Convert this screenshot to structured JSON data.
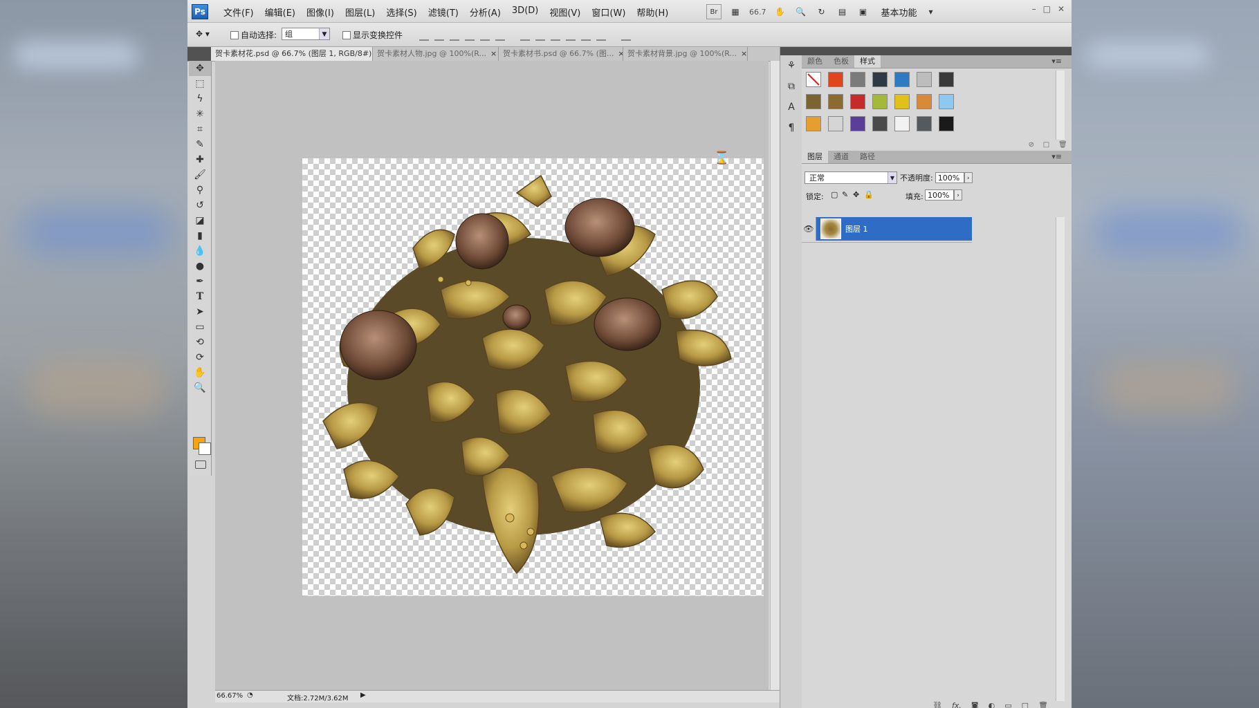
{
  "app": {
    "logo": "Ps"
  },
  "menu": [
    "文件(F)",
    "编辑(E)",
    "图像(I)",
    "图层(L)",
    "选择(S)",
    "滤镜(T)",
    "分析(A)",
    "3D(D)",
    "视图(V)",
    "窗口(W)",
    "帮助(H)"
  ],
  "appbar": {
    "bridge": "Br",
    "zoom": "66.7",
    "workspace": "基本功能"
  },
  "options": {
    "auto_select_label": "自动选择:",
    "auto_select_value": "组",
    "transform_label": "显示变换控件"
  },
  "tabs": [
    {
      "label": "贺卡素材花.psd @ 66.7% (图层 1, RGB/8#)",
      "active": true
    },
    {
      "label": "贺卡素材人物.jpg @ 100%(R...",
      "active": false
    },
    {
      "label": "贺卡素材书.psd @ 66.7% (图...",
      "active": false
    },
    {
      "label": "贺卡素材背景.jpg @ 100%(R...",
      "active": false
    }
  ],
  "colors": {
    "foreground": "#f7a50f",
    "background": "#ffffff",
    "layer_highlight": "#2f6cc6"
  },
  "statusbar": {
    "zoom": "66.67%",
    "doc": "文档:2.72M/3.62M"
  },
  "panels": {
    "top_tabs": [
      "颜色",
      "色板",
      "样式"
    ],
    "top_active": 2,
    "layer_tabs": [
      "图层",
      "通道",
      "路径"
    ],
    "layer_active": 0,
    "blend_mode": "正常",
    "opacity_label": "不透明度:",
    "opacity": "100%",
    "lock_label": "锁定:",
    "fill_label": "填充:",
    "fill": "100%",
    "layer_name": "图层 1"
  },
  "styles": [
    "none",
    "fire",
    "gray",
    "chrome",
    "blue-glass",
    "light-gray",
    "dark-gradient",
    "bronze",
    "gold-brown",
    "red",
    "rainbow",
    "yellow-star",
    "orange",
    "sky",
    "sunset",
    "texture",
    "purple",
    "charcoal",
    "white",
    "slate",
    "black"
  ]
}
